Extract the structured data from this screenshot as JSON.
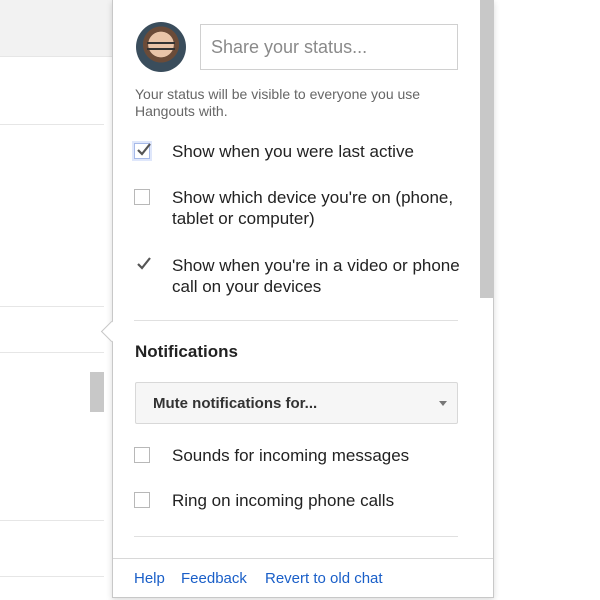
{
  "status": {
    "placeholder": "Share your status...",
    "note": "Your status will be visible to everyone you use Hangouts with."
  },
  "privacy_options": [
    {
      "label": "Show when you were last active",
      "checked": true
    },
    {
      "label": "Show which device you're on (phone, tablet or computer)",
      "checked": false
    },
    {
      "label": "Show when you're in a video or phone call on your devices",
      "checked": true
    }
  ],
  "notifications": {
    "title": "Notifications",
    "mute_select": "Mute notifications for...",
    "options": [
      {
        "label": "Sounds for incoming messages",
        "checked": false
      },
      {
        "label": "Ring on incoming phone calls",
        "checked": false
      }
    ]
  },
  "footer": {
    "help": "Help",
    "feedback": "Feedback",
    "revert": "Revert to old chat"
  },
  "colors": {
    "link": "#1a5fc8",
    "check": "#555555",
    "divider": "#e0e0e0"
  }
}
